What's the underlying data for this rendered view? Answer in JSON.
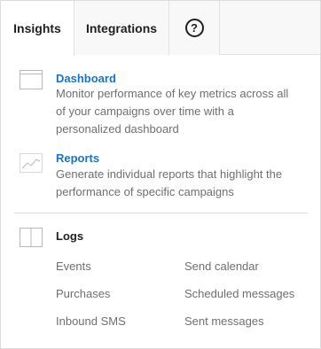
{
  "tabs": [
    {
      "label": "Insights"
    },
    {
      "label": "Integrations"
    }
  ],
  "help_icon": {
    "glyph": "?"
  },
  "items": {
    "dashboard": {
      "title": "Dashboard",
      "description_lines": [
        "Monitor performance of key metrics across all",
        "of your campaigns over time with a",
        "personalized dashboard"
      ]
    },
    "reports": {
      "title": "Reports",
      "description_lines": [
        "Generate individual reports that highlight the",
        "performance of specific campaigns"
      ]
    }
  },
  "logs": {
    "title": "Logs",
    "links": [
      "Events",
      "Send calendar",
      "Purchases",
      "Scheduled messages",
      "Inbound SMS",
      "Sent messages"
    ]
  },
  "colors": {
    "accent": "#1a73c9",
    "text_dark": "#1f1f1f",
    "text_muted": "#6f6f6f",
    "border": "#e1e1e1"
  },
  "icons": [
    "help-circle-icon",
    "dashboard-window-icon",
    "reports-chart-icon",
    "logs-book-icon"
  ]
}
